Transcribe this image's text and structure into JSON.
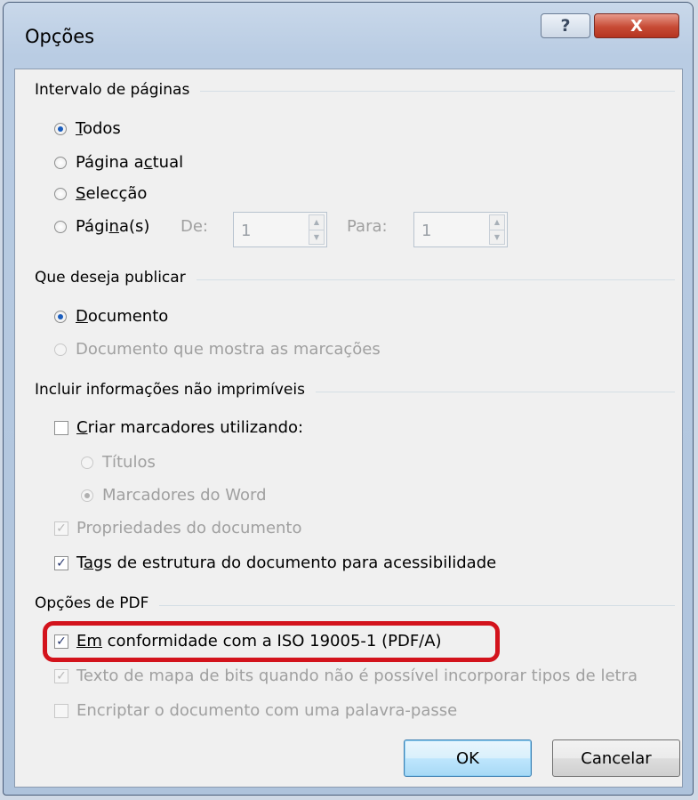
{
  "window": {
    "title": "Opções",
    "help_glyph": "?",
    "close_glyph": "X"
  },
  "page_range": {
    "label": "Intervalo de páginas",
    "all": {
      "pre": "",
      "ul": "T",
      "post": "odos"
    },
    "current": {
      "pre": "Página a",
      "ul": "c",
      "post": "tual"
    },
    "selection": {
      "pre": "",
      "ul": "S",
      "post": "elecção"
    },
    "pages": {
      "pre": "Pági",
      "ul": "n",
      "post": "a(s)"
    },
    "from_label": "De:",
    "from_value": "1",
    "to_label": "Para:",
    "to_value": "1",
    "spin_up": "▲",
    "spin_down": "▼"
  },
  "publish": {
    "label": "Que deseja publicar",
    "document": {
      "pre": "",
      "ul": "D",
      "post": "ocumento"
    },
    "markup": "Documento que mostra as marcações"
  },
  "nonprint": {
    "label": "Incluir informações não imprimíveis",
    "bookmarks": {
      "pre": "",
      "ul": "C",
      "post": "riar marcadores utilizando:"
    },
    "headings": "Títulos",
    "word_bookmarks": "Marcadores do Word",
    "doc_properties": "Propriedades do documento",
    "structure_tags": {
      "pre": "T",
      "ul": "a",
      "post": "gs de estrutura do documento para acessibilidade"
    }
  },
  "pdf_options": {
    "label": "Opções de PDF",
    "iso": {
      "pre": "",
      "ul": "Em",
      "post": " conformidade com a ISO 19005-1 (PDF/A)"
    },
    "bitmap_text": "Texto de mapa de bits quando não é possível incorporar tipos de letra",
    "encrypt": "Encriptar o documento com uma palavra-passe"
  },
  "buttons": {
    "ok": "OK",
    "cancel": "Cancelar"
  },
  "check_glyph": "✓"
}
